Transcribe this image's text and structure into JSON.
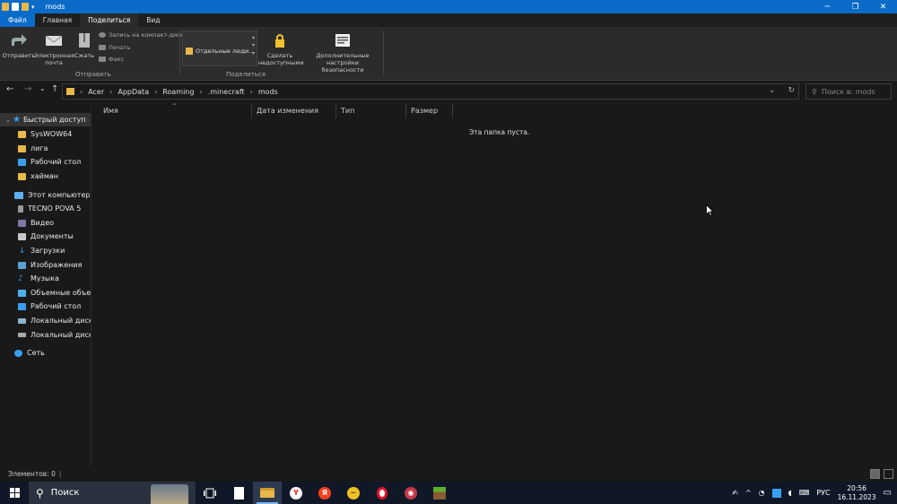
{
  "window": {
    "title": "mods",
    "controls": {
      "minimize": "─",
      "maximize": "❐",
      "close": "✕"
    }
  },
  "ribbon_tabs": [
    "Файл",
    "Главная",
    "Поделиться",
    "Вид"
  ],
  "ribbon": {
    "send_group": {
      "label": "Отправить",
      "send": "Отправить",
      "email_line1": "Электронная",
      "email_line2": "почта",
      "zip": "Сжать",
      "burn": "Запись на компакт-диск",
      "print": "Печать",
      "fax": "Факс"
    },
    "share_group": {
      "label": "Поделиться",
      "gallery_item": "Отдельные люди...",
      "stop_line1": "Сделать",
      "stop_line2": "недоступными",
      "advanced_line1": "Дополнительные",
      "advanced_line2": "настройки безопасности"
    }
  },
  "nav": {
    "back": "←",
    "forward": "→",
    "recent": "⌄",
    "up": "↑",
    "path": [
      "Acer",
      "AppData",
      "Roaming",
      ".minecraft",
      "mods"
    ],
    "search_placeholder": "Поиск в: mods"
  },
  "sidebar": {
    "quick_access": "Быстрый доступ",
    "pinned": [
      "SysWOW64",
      "лига",
      "Рабочий стол",
      "хайман"
    ],
    "this_pc": "Этот компьютер",
    "pc_items": [
      "TECNO POVA 5",
      "Видео",
      "Документы",
      "Загрузки",
      "Изображения",
      "Музыка",
      "Объемные объекты",
      "Рабочий стол",
      "Локальный диск (C:)",
      "Локальный диск (D:)"
    ],
    "network": "Сеть"
  },
  "columns": [
    "Имя",
    "Дата изменения",
    "Тип",
    "Размер"
  ],
  "empty_message": "Эта папка пуста.",
  "status": {
    "items": "Элементов: 0"
  },
  "taskbar": {
    "search": "Поиск",
    "lang": "РУС",
    "time": "20:56",
    "date": "16.11.2023"
  },
  "colors": {
    "title_bar": "#0a6bc8",
    "background": "#191919",
    "ribbon": "#2b2b2b",
    "taskbar": "#101828",
    "folder": "#e8b84a"
  }
}
